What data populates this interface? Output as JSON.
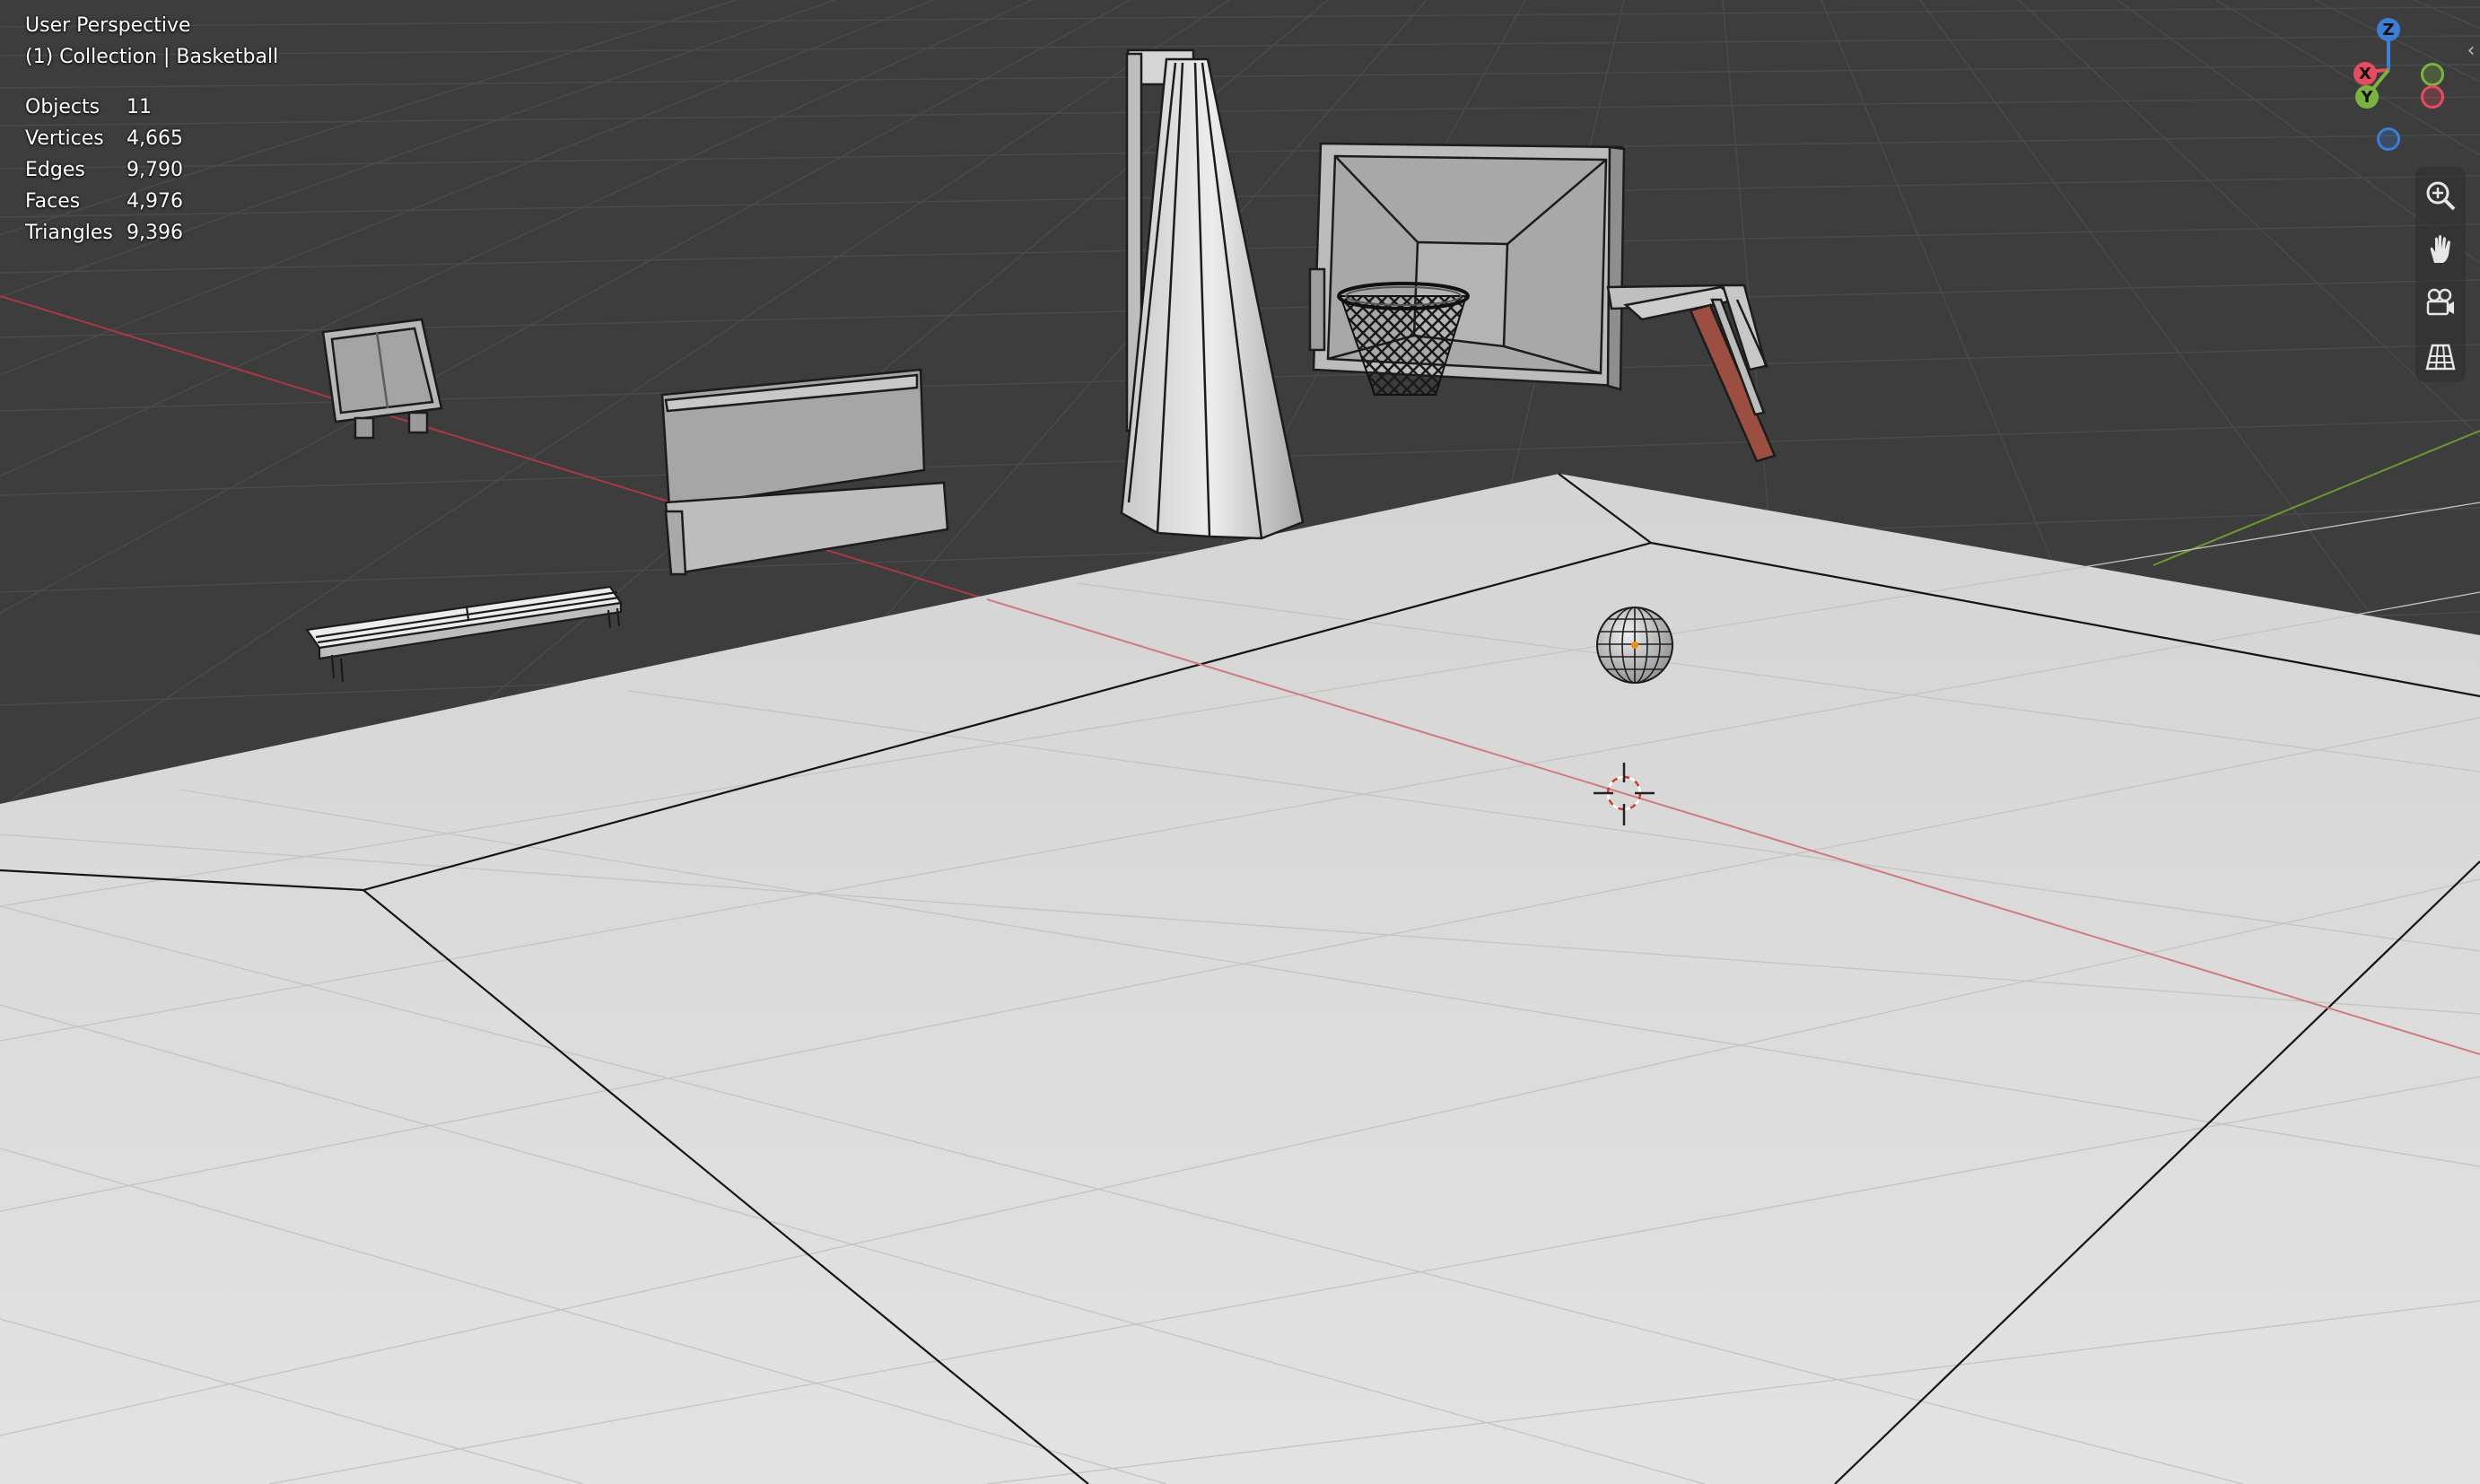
{
  "viewport": {
    "view_title": "User Perspective",
    "collection_line": "(1) Collection | Basketball"
  },
  "stats": [
    {
      "label": "Objects",
      "value": "11"
    },
    {
      "label": "Vertices",
      "value": "4,665"
    },
    {
      "label": "Edges",
      "value": "9,790"
    },
    {
      "label": "Faces",
      "value": "4,976"
    },
    {
      "label": "Triangles",
      "value": "9,396"
    }
  ],
  "gizmo": {
    "z_label": "Z",
    "x_label": "X",
    "y_label": "Y",
    "colors": {
      "x": "#e84a5f",
      "y": "#7ab340",
      "z": "#3d7fd6"
    }
  },
  "tools": [
    {
      "name": "zoom-icon"
    },
    {
      "name": "pan-hand-icon"
    },
    {
      "name": "camera-view-icon"
    },
    {
      "name": "ortho-grid-icon"
    }
  ],
  "colors": {
    "background": "#3d3d3d",
    "floor": "#dcdcdc",
    "grid": "#4a4a4a",
    "x_axis": "#b0353e",
    "y_axis": "#6c9a2e"
  }
}
